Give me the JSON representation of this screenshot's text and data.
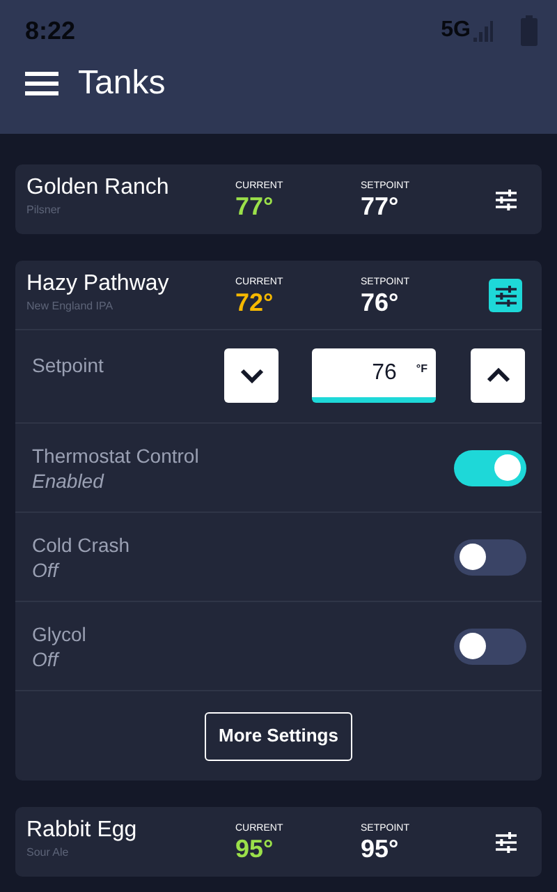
{
  "status_bar": {
    "time": "8:22",
    "network": "5G"
  },
  "header": {
    "title": "Tanks"
  },
  "tanks": [
    {
      "name": "Golden Ranch",
      "style": "Pilsner",
      "current_label": "CURRENT",
      "current": "77°",
      "color": "#9be04a",
      "setpoint_label": "SETPOINT",
      "setpoint": "77°",
      "expanded": false
    },
    {
      "name": "Hazy Pathway",
      "style": "New England IPA",
      "current_label": "CURRENT",
      "current": "72°",
      "color": "#f5b800",
      "setpoint_label": "SETPOINT",
      "setpoint": "76°",
      "expanded": true,
      "details": {
        "setpoint": {
          "label": "Setpoint",
          "value": "76",
          "unit": "°F"
        },
        "toggles": [
          {
            "label": "Thermostat Control",
            "state": "Enabled",
            "on": true
          },
          {
            "label": "Cold Crash",
            "state": "Off",
            "on": false
          },
          {
            "label": "Glycol",
            "state": "Off",
            "on": false
          }
        ],
        "button": "More Settings"
      }
    },
    {
      "name": "Rabbit Egg",
      "style": "Sour Ale",
      "current_label": "CURRENT",
      "current": "95°",
      "color": "#9be04a",
      "setpoint_label": "SETPOINT",
      "setpoint": "95°",
      "expanded": false
    }
  ]
}
